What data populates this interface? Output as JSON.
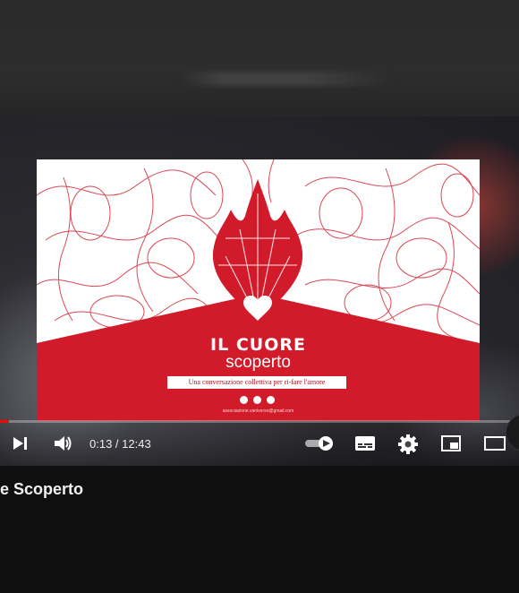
{
  "poster": {
    "title": "IL CUORE",
    "subtitle": "scoperto",
    "tagline": "Una conversazione collettiva per ri-fare l'amore",
    "email": "associazione.vaniverso@gmail.com"
  },
  "player": {
    "time": "0:13 / 12:43",
    "progress_fraction": 0.017,
    "autoplay_on": true
  },
  "video_title": "e Scoperto",
  "colors": {
    "brand_red": "#d11a2a",
    "progress_red": "#ff0000"
  }
}
